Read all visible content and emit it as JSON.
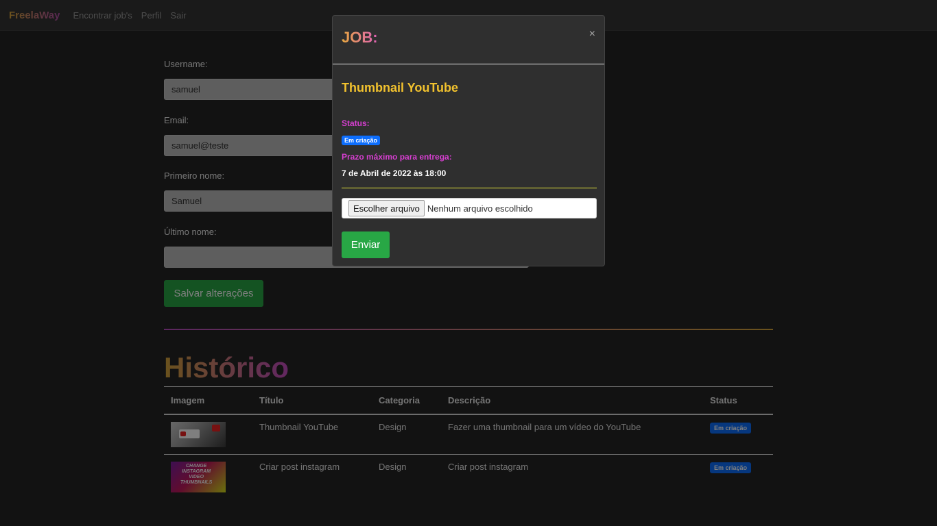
{
  "navbar": {
    "brand": "FreelaWay",
    "links": [
      "Encontrar job's",
      "Perfil",
      "Sair"
    ]
  },
  "profile_form": {
    "username_label": "Username:",
    "username_value": "samuel",
    "email_label": "Email:",
    "email_value": "samuel@teste",
    "first_name_label": "Primeiro nome:",
    "first_name_value": "Samuel",
    "last_name_label": "Último nome:",
    "last_name_value": "",
    "save_label": "Salvar alterações"
  },
  "history": {
    "title": "Histórico",
    "columns": [
      "Imagem",
      "Título",
      "Categoria",
      "Descrição",
      "Status"
    ],
    "rows": [
      {
        "image": "youtube-thumbnail-image",
        "title": "Thumbnail YouTube",
        "category": "Design",
        "description": "Fazer uma thumbnail para um vídeo do YouTube",
        "status": "Em criação"
      },
      {
        "image": "instagram-thumbnail-image",
        "image_text": "Change instagram video thumbnails",
        "title": "Criar post instagram",
        "category": "Design",
        "description": "Criar post instagram",
        "status": "Em criação"
      }
    ]
  },
  "modal": {
    "title": "JOB:",
    "close_icon": "×",
    "job_title": "Thumbnail YouTube",
    "status_label": "Status:",
    "status_badge": "Em criação",
    "deadline_label": "Prazo máximo para entrega:",
    "deadline_value": "7 de Abril de 2022 às 18:00",
    "file_button": "Escolher arquivo",
    "file_status": "Nenhum arquivo escolhido",
    "send_label": "Enviar"
  },
  "colors": {
    "success": "#28a745",
    "badge": "#0d6efd",
    "job_title": "#f2c22e",
    "modal_label": "#d63fd0"
  }
}
